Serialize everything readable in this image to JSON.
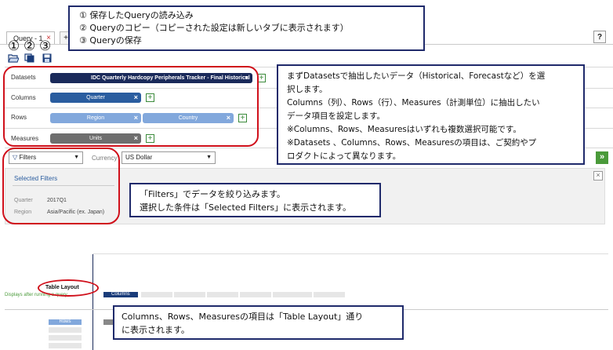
{
  "top_callout": {
    "lines": [
      "① 保存したQueryの読み込み",
      "② Queryのコピー（コピーされた設定は新しいタブに表示されます）",
      "③ Queryの保存"
    ]
  },
  "tabs": {
    "tab1_label": "Query - 1",
    "tab1_close": "×",
    "add_tab": "+"
  },
  "help_label": "?",
  "markers": [
    "①",
    "②",
    "③"
  ],
  "rows": {
    "datasets": {
      "label": "Datasets",
      "value": "IDC Quarterly Hardcopy Peripherals Tracker - Final Historical"
    },
    "columns": {
      "label": "Columns",
      "pills": [
        "Quarter"
      ]
    },
    "rows": {
      "label": "Rows",
      "pills": [
        "Region",
        "Country"
      ]
    },
    "measures": {
      "label": "Measures",
      "pills": [
        "Units"
      ]
    }
  },
  "right_callout": {
    "lines": [
      "まずDatasetsで抽出したいデータ（Historical、Forecastなど）を選",
      "択します。",
      "Columns（列）、Rows（行）、Measures（計測単位）に抽出したい",
      "データ項目を設定します。",
      "※Columns、Rows、Measuresはいずれも複数選択可能です。",
      "※Datasets 、Columns、Rows、Measuresの項目は、ご契約やプ",
      "ロダクトによって異なります。"
    ]
  },
  "filters": {
    "dropdown_label": "Filters",
    "currency_label": "Currency",
    "currency_value": "US Dollar",
    "selected_title": "Selected Filters",
    "close": "×",
    "items": [
      {
        "key": "Quarter",
        "value": "2017Q1"
      },
      {
        "key": "Region",
        "value": "Asia/Pacific (ex. Japan)"
      }
    ]
  },
  "go_button": "»",
  "filters_callout": {
    "lines": [
      "「Filters」でデータを絞り込みます。",
      "選択した条件は「Selected Filters」に表示されます。"
    ]
  },
  "layout": {
    "title": "Table Layout",
    "subtitle": "Displays after running a query",
    "columns_chip": "Columns",
    "rows_chip": "Rows"
  },
  "bottom_callout": {
    "lines": [
      "Columns、Rows、Measuresの項目は「Table Layout」通り",
      "に表示されます。"
    ]
  },
  "colors": {
    "navy": "#1f2a6b",
    "dark_pill": "#1a2a5a",
    "blue_pill": "#2a5d9f",
    "light_pill": "#82a8dc",
    "measure_pill": "#6e6e6e",
    "red": "#d0101b",
    "green": "#4a9a3a"
  }
}
